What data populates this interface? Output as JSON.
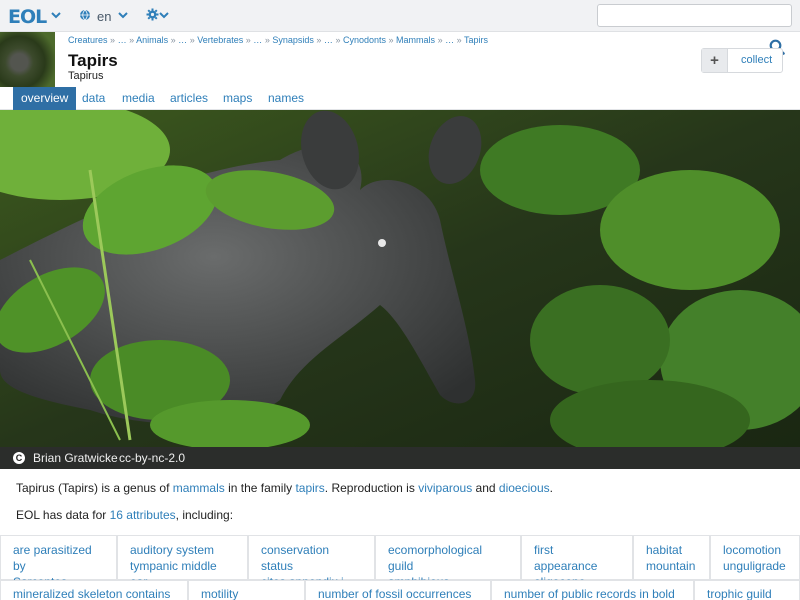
{
  "topbar": {
    "logo": "EOL",
    "language": "en"
  },
  "header": {
    "breadcrumbs": [
      "Creatures",
      "…",
      "Animals",
      "…",
      "Vertebrates",
      "…",
      "Synapsids",
      "…",
      "Cynodonts",
      "Mammals",
      "…",
      "Tapirs"
    ],
    "breadcrumb_separator": "»",
    "title": "Tapirs",
    "subtitle": "Tapirus",
    "collect_plus": "+",
    "collect_label": "collect"
  },
  "tabs": [
    {
      "label": "overview",
      "active": true
    },
    {
      "label": "data",
      "active": false
    },
    {
      "label": "media",
      "active": false
    },
    {
      "label": "articles",
      "active": false
    },
    {
      "label": "maps",
      "active": false
    },
    {
      "label": "names",
      "active": false
    }
  ],
  "photo": {
    "author": "Brian Gratwicke",
    "license": "cc-by-nc-2.0",
    "credit_icon": "C"
  },
  "description": {
    "p1": "Tapirus (Tapirs) is a genus of ",
    "link1": "mammals",
    "p2": " in the family ",
    "link2": "tapirs",
    "p3": ". Reproduction is ",
    "link3": "viviparous",
    "p4": " and ",
    "link4": "dioecious",
    "p5": "."
  },
  "data_summary": {
    "prefix": "EOL has data for ",
    "link": "16 attributes",
    "suffix": ", including:"
  },
  "attributes": [
    {
      "label": "are parasitized by",
      "value": "Sarcoptes"
    },
    {
      "label": "auditory system",
      "value": "tympanic middle ear"
    },
    {
      "label": "conservation status",
      "value": "cites appendix i"
    },
    {
      "label": "ecomorphological guild",
      "value": "amphibious"
    },
    {
      "label": "first appearance",
      "value": "oligocene epoch"
    },
    {
      "label": "habitat",
      "value": "mountain"
    },
    {
      "label": "locomotion",
      "value": "unguligrade"
    },
    {
      "label": "mineralized skeleton contains",
      "value": ""
    },
    {
      "label": "motility",
      "value": ""
    },
    {
      "label": "number of fossil occurrences",
      "value": ""
    },
    {
      "label": "number of public records in bold",
      "value": ""
    },
    {
      "label": "trophic guild",
      "value": ""
    }
  ],
  "colors": {
    "link": "#2f7fb9",
    "active_tab": "#2f6fa5",
    "topbar": "#f1f2f4"
  },
  "icons": [
    "eol-logo",
    "chevron-down-icon",
    "globe-icon",
    "gear-icon",
    "search-icon",
    "plus-icon",
    "creative-commons-icon"
  ]
}
